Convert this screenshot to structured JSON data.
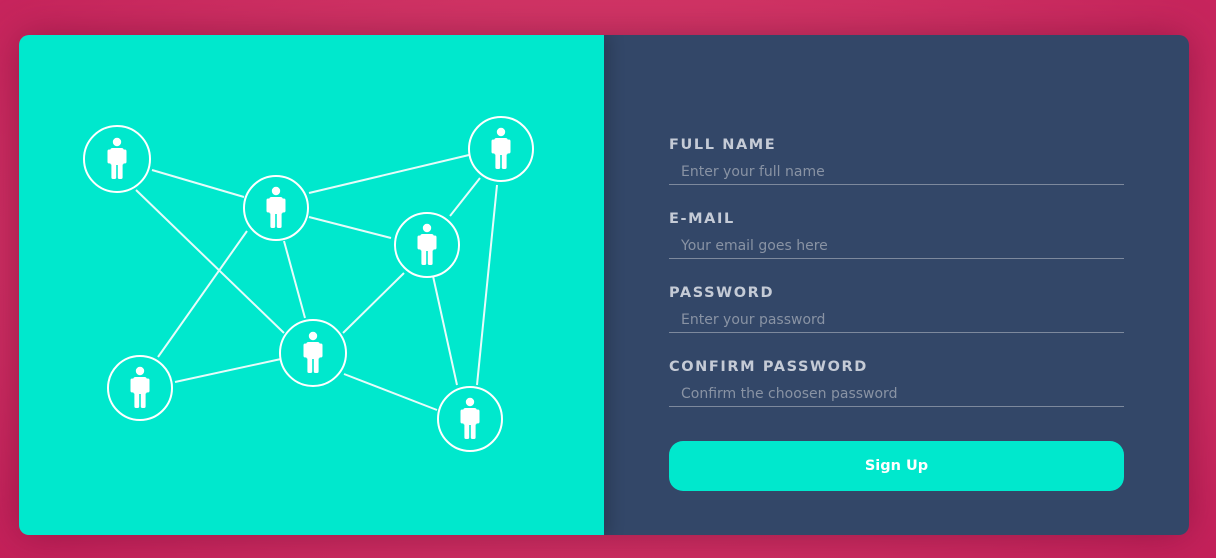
{
  "colors": {
    "background": "#c8245c",
    "accent": "#00e8cd",
    "panel": "#334768",
    "label": "#c5cbd6"
  },
  "illustration": {
    "icon": "person-icon",
    "node_count": 7
  },
  "form": {
    "fields": [
      {
        "label": "FULL NAME",
        "placeholder": "Enter your full name",
        "type": "text"
      },
      {
        "label": "E-MAIL",
        "placeholder": "Your email goes here",
        "type": "email"
      },
      {
        "label": "PASSWORD",
        "placeholder": "Enter your password",
        "type": "password"
      },
      {
        "label": "CONFIRM PASSWORD",
        "placeholder": "Confirm the choosen password",
        "type": "password"
      }
    ],
    "submit_label": "Sign Up"
  }
}
